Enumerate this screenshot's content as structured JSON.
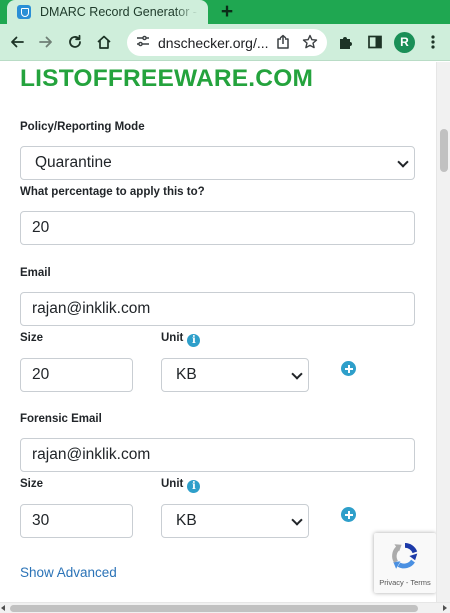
{
  "browser": {
    "tab_title": "DMARC Record Generator - C",
    "url": "dnschecker.org/...",
    "profile_initial": "R",
    "theme_color": "#1fa751"
  },
  "page": {
    "logo_text": "LISTOFFREEWARE.COM",
    "policy": {
      "label": "Policy/Reporting Mode",
      "value": "Quarantine"
    },
    "percentage": {
      "label": "What percentage to apply this to?",
      "value": "20"
    },
    "email": {
      "label": "Email",
      "value": "rajan@inklik.com",
      "size_label": "Size",
      "size_value": "20",
      "unit_label": "Unit",
      "unit_value": "KB"
    },
    "forensic": {
      "label": "Forensic Email",
      "value": "rajan@inklik.com",
      "size_label": "Size",
      "size_value": "30",
      "unit_label": "Unit",
      "unit_value": "KB"
    },
    "show_advanced": "Show Advanced",
    "accent_color": "#2e9fca",
    "logo_color": "#24a33d"
  },
  "recaptcha": {
    "links": "Privacy - Terms"
  },
  "icons": {
    "back": "arrow-left-icon",
    "forward": "arrow-right-icon",
    "reload": "reload-icon",
    "home": "home-icon",
    "site_info": "tune-icon",
    "share": "share-icon",
    "bookmark": "star-icon",
    "extensions": "puzzle-icon",
    "side_panel": "sidebar-icon",
    "menu": "kebab-menu-icon",
    "info": "info-icon",
    "add": "plus-circle-icon"
  }
}
